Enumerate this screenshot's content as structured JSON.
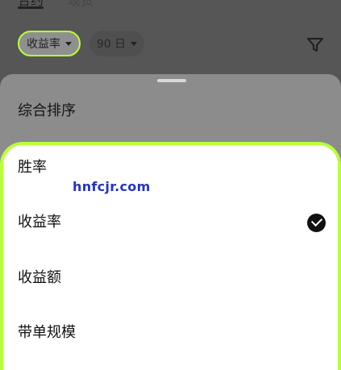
{
  "background": {
    "tabs": [
      {
        "label": "合约"
      },
      {
        "label": "现货"
      }
    ],
    "filters": {
      "sort_label": "收益率",
      "period_label": "90 日"
    },
    "filter_icon": "funnel-icon"
  },
  "sheet": {
    "options": [
      {
        "label": "综合排序"
      },
      {
        "label": "胜率"
      },
      {
        "label": "收益率",
        "selected": true
      },
      {
        "label": "收益额"
      },
      {
        "label": "带单规模"
      }
    ],
    "selected_icon": "check-circle-icon"
  },
  "watermark": "hnfcjr.com",
  "colors": {
    "highlight": "#b9ff3a",
    "watermark": "#2533c6"
  }
}
